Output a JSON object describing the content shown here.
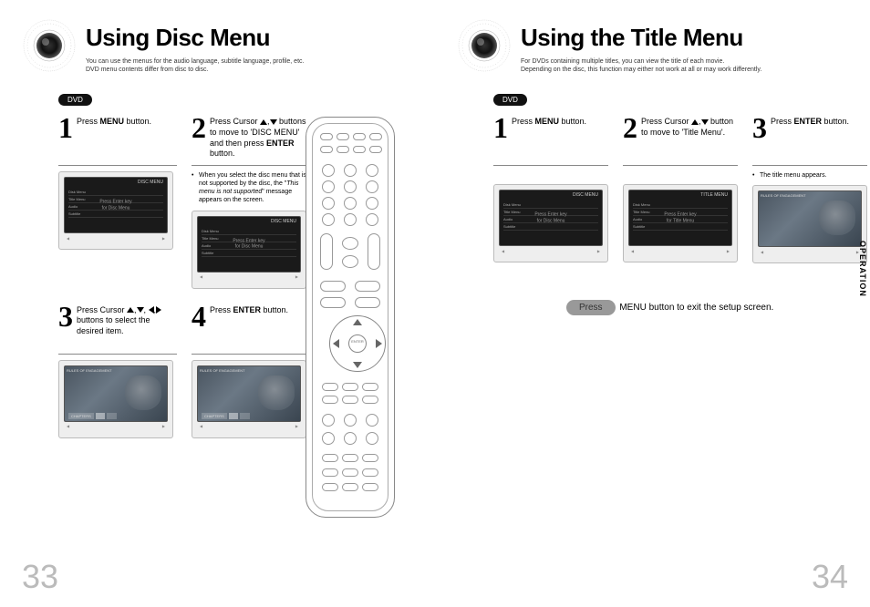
{
  "left": {
    "title": "Using Disc Menu",
    "subtitle1": "You can use the menus for the audio language, subtitle language, profile, etc.",
    "subtitle2": "DVD menu contents differ from disc to disc.",
    "badge": "DVD",
    "step1_num": "1",
    "step1_text_a": "Press ",
    "step1_text_b": "MENU",
    "step1_text_c": " button.",
    "step2_num": "2",
    "step2_text": "Press Cursor ▲,▼ buttons to move to 'DISC MENU' and then press ENTER button.",
    "step2_note_a": "When you select the disc menu that is not supported by the disc, the \"",
    "step2_note_b": "This menu is not supported",
    "step2_note_c": "\" message appears on the screen.",
    "step3_num": "3",
    "step3_text": "Press Cursor ▲,▼, ◀,▶ buttons to select the desired item.",
    "step4_num": "4",
    "step4_text_a": "Press ",
    "step4_text_b": "ENTER",
    "step4_text_c": " button.",
    "tv_disc_menu": "DISC MENU",
    "tv_menu1": "Disk Menu",
    "tv_menu2": "Title Menu",
    "tv_menu3": "Audio",
    "tv_menu4": "Subtitle",
    "tv_center1": "Press Enter key",
    "tv_center2": "for Disc Menu",
    "tv_movie_title": "RULES OF ENGAGEMENT",
    "tv_chapter": "CHAPTERS",
    "page_num": "33"
  },
  "right": {
    "title": "Using the Title Menu",
    "subtitle1": "For DVDs containing multiple titles, you can view the title of each movie.",
    "subtitle2": "Depending on the disc, this function may either not work at all or may work differently.",
    "badge": "DVD",
    "step1_num": "1",
    "step1_text_a": "Press ",
    "step1_text_b": "MENU",
    "step1_text_c": " button.",
    "step2_num": "2",
    "step2_text": "Press Cursor ▲,▼ button to move to 'Title Menu'.",
    "step3_num": "3",
    "step3_text_a": "Press ",
    "step3_text_b": "ENTER",
    "step3_text_c": " button.",
    "step3_note": "The title menu appears.",
    "tv_disc_menu": "DISC MENU",
    "tv_title_menu": "TITLE MENU",
    "tv_menu1": "Disk Menu",
    "tv_menu2": "Title Menu",
    "tv_menu3": "Audio",
    "tv_menu4": "Subtitle",
    "tv_center1": "Press Enter key",
    "tv_center2": "for Disc Menu",
    "tv_center3": "Press Enter key",
    "tv_center4": "for Title Menu",
    "tv_movie_title": "RULES OF ENGAGEMENT",
    "footer_pill": "Press",
    "footer_text_a": " ",
    "footer_text_b": "MENU",
    "footer_text_c": " button to exit the setup screen.",
    "side_tab": "OPERATION",
    "page_num": "34"
  },
  "remote": {
    "enter": "ENTER"
  }
}
